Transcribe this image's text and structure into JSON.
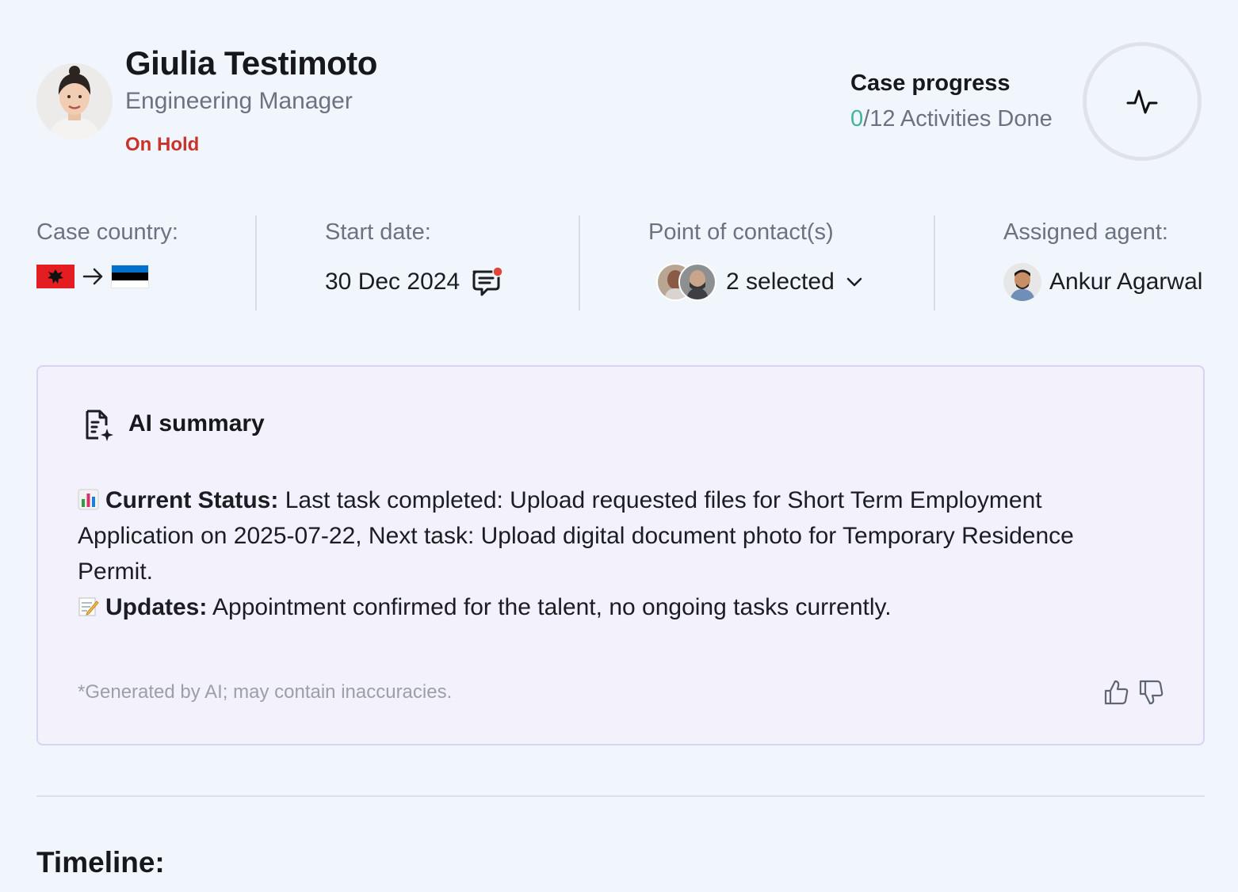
{
  "profile": {
    "name": "Giulia Testimoto",
    "role": "Engineering Manager",
    "status": "On Hold",
    "status_color": "#c8332b"
  },
  "progress": {
    "title": "Case progress",
    "done": "0",
    "rest": "/12 Activities Done",
    "fraction": 0,
    "accent": "#3fb59b",
    "icon": "activity-pulse-icon"
  },
  "info": {
    "country": {
      "label": "Case country:",
      "from_flag": "albania-flag",
      "to_flag": "estonia-flag",
      "arrow_icon": "arrow-right-icon"
    },
    "start": {
      "label": "Start date:",
      "value": "30 Dec 2024",
      "icon": "message-comment-icon"
    },
    "contacts": {
      "label": "Point of contact(s)",
      "value": "2 selected",
      "icon": "chevron-down-icon"
    },
    "agent": {
      "label": "Assigned agent:",
      "value": "Ankur Agarwal"
    }
  },
  "ai_summary": {
    "title": "AI summary",
    "current_status_label": "Current Status:",
    "current_status_text": " Last task completed: Upload requested files for Short Term Employment Application on 2025-07-22, Next task: Upload digital document photo for Temporary Residence Permit.",
    "updates_label": "Updates:",
    "updates_text": " Appointment confirmed for the talent, no ongoing tasks currently.",
    "disclaimer": "*Generated by AI; may contain inaccuracies."
  },
  "timeline": {
    "title": "Timeline:"
  }
}
